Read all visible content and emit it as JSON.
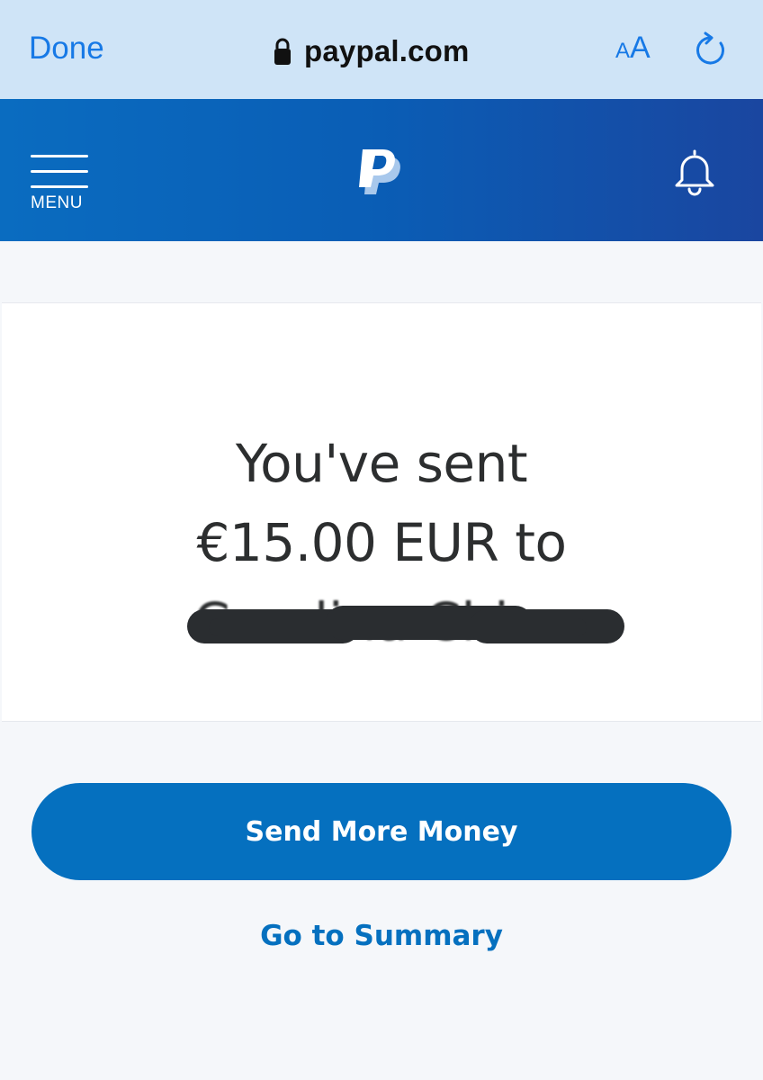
{
  "browser": {
    "done_label": "Done",
    "url": "paypal.com",
    "text_size_small": "A",
    "text_size_large": "A",
    "icons": [
      "lock-icon",
      "text-size-icon",
      "reload-icon"
    ],
    "accent_color": "#1779e6",
    "bar_color": "#cfe4f7"
  },
  "header": {
    "menu_label": "MENU",
    "icons": [
      "hamburger-menu-icon",
      "paypal-logo",
      "bell-icon"
    ],
    "brand_color": "#0a5db5"
  },
  "confirmation": {
    "line_1": "You've sent",
    "line_2": "€15.00 EUR to",
    "recipient": "Carolina Chica",
    "recipient_redacted": true
  },
  "actions": {
    "send_more_label": "Send More Money",
    "summary_label": "Go to Summary",
    "button_color": "#0570bf"
  }
}
